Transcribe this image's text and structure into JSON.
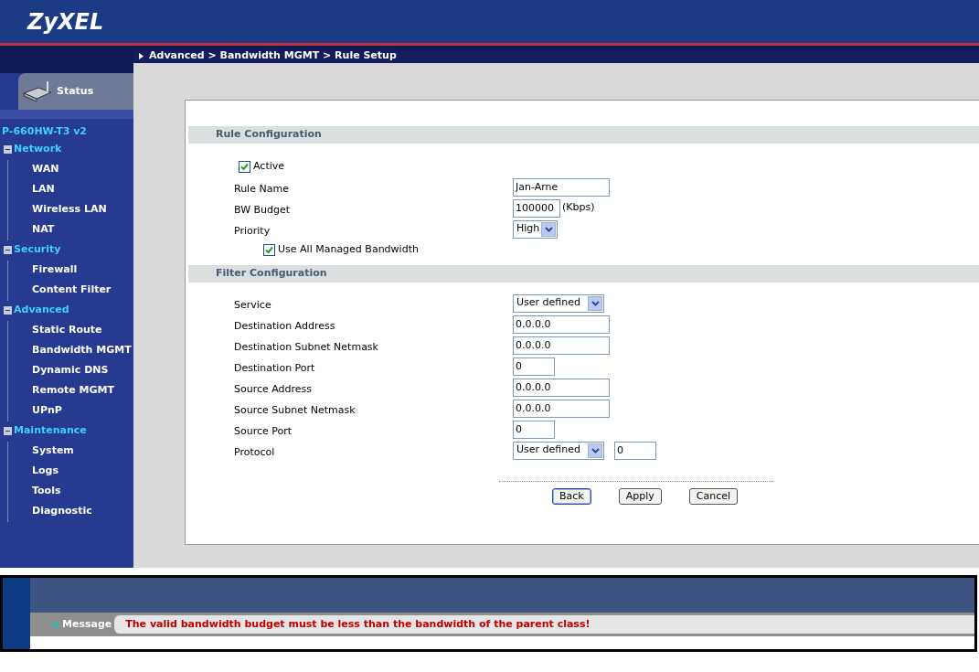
{
  "header": {
    "logo": "ZyXEL"
  },
  "breadcrumb": "Advanced > Bandwidth MGMT > Rule Setup",
  "sidebar": {
    "status_tab": "Status",
    "model": "P-660HW-T3 v2",
    "groups": [
      {
        "label": "Network",
        "expanded": true,
        "children": [
          {
            "label": "WAN"
          },
          {
            "label": "LAN"
          },
          {
            "label": "Wireless LAN"
          },
          {
            "label": "NAT"
          }
        ]
      },
      {
        "label": "Security",
        "expanded": true,
        "children": [
          {
            "label": "Firewall"
          },
          {
            "label": "Content Filter"
          }
        ]
      },
      {
        "label": "Advanced",
        "expanded": true,
        "children": [
          {
            "label": "Static Route"
          },
          {
            "label": "Bandwidth MGMT"
          },
          {
            "label": "Dynamic DNS"
          },
          {
            "label": "Remote MGMT"
          },
          {
            "label": "UPnP"
          }
        ]
      },
      {
        "label": "Maintenance",
        "expanded": true,
        "children": [
          {
            "label": "System"
          },
          {
            "label": "Logs"
          },
          {
            "label": "Tools"
          },
          {
            "label": "Diagnostic"
          }
        ]
      }
    ]
  },
  "sections": [
    {
      "title": "Rule Configuration",
      "rows": [
        {
          "kind": "checkbox",
          "label": "Active",
          "checked": true
        },
        {
          "kind": "text_long",
          "label": "Rule Name",
          "value": "Jan-Arne"
        },
        {
          "kind": "text_unit",
          "label": "BW Budget",
          "value": "100000",
          "unit": "(Kbps)"
        },
        {
          "kind": "select_short",
          "label": "Priority",
          "value": "High"
        },
        {
          "kind": "checkbox_indented",
          "label": "Use All Managed Bandwidth",
          "checked": true
        }
      ]
    },
    {
      "title": "Filter Configuration",
      "rows": [
        {
          "kind": "select",
          "label": "Service",
          "value": "User defined"
        },
        {
          "kind": "text_long",
          "label": "Destination Address",
          "value": "0.0.0.0"
        },
        {
          "kind": "text_long",
          "label": "Destination Subnet Netmask",
          "value": "0.0.0.0"
        },
        {
          "kind": "text_short",
          "label": "Destination Port",
          "value": "0"
        },
        {
          "kind": "text_long",
          "label": "Source Address",
          "value": "0.0.0.0"
        },
        {
          "kind": "text_long",
          "label": "Source Subnet Netmask",
          "value": "0.0.0.0"
        },
        {
          "kind": "text_short",
          "label": "Source Port",
          "value": "0"
        },
        {
          "kind": "select_text",
          "label": "Protocol",
          "value": "User defined",
          "extra": "0"
        }
      ]
    }
  ],
  "buttons": [
    {
      "label": "Back",
      "selected": true
    },
    {
      "label": "Apply",
      "selected": false
    },
    {
      "label": "Cancel",
      "selected": false
    }
  ],
  "message": {
    "label": "Message",
    "text": "The valid bandwidth budget must be less than the bandwidth of the parent class!"
  }
}
